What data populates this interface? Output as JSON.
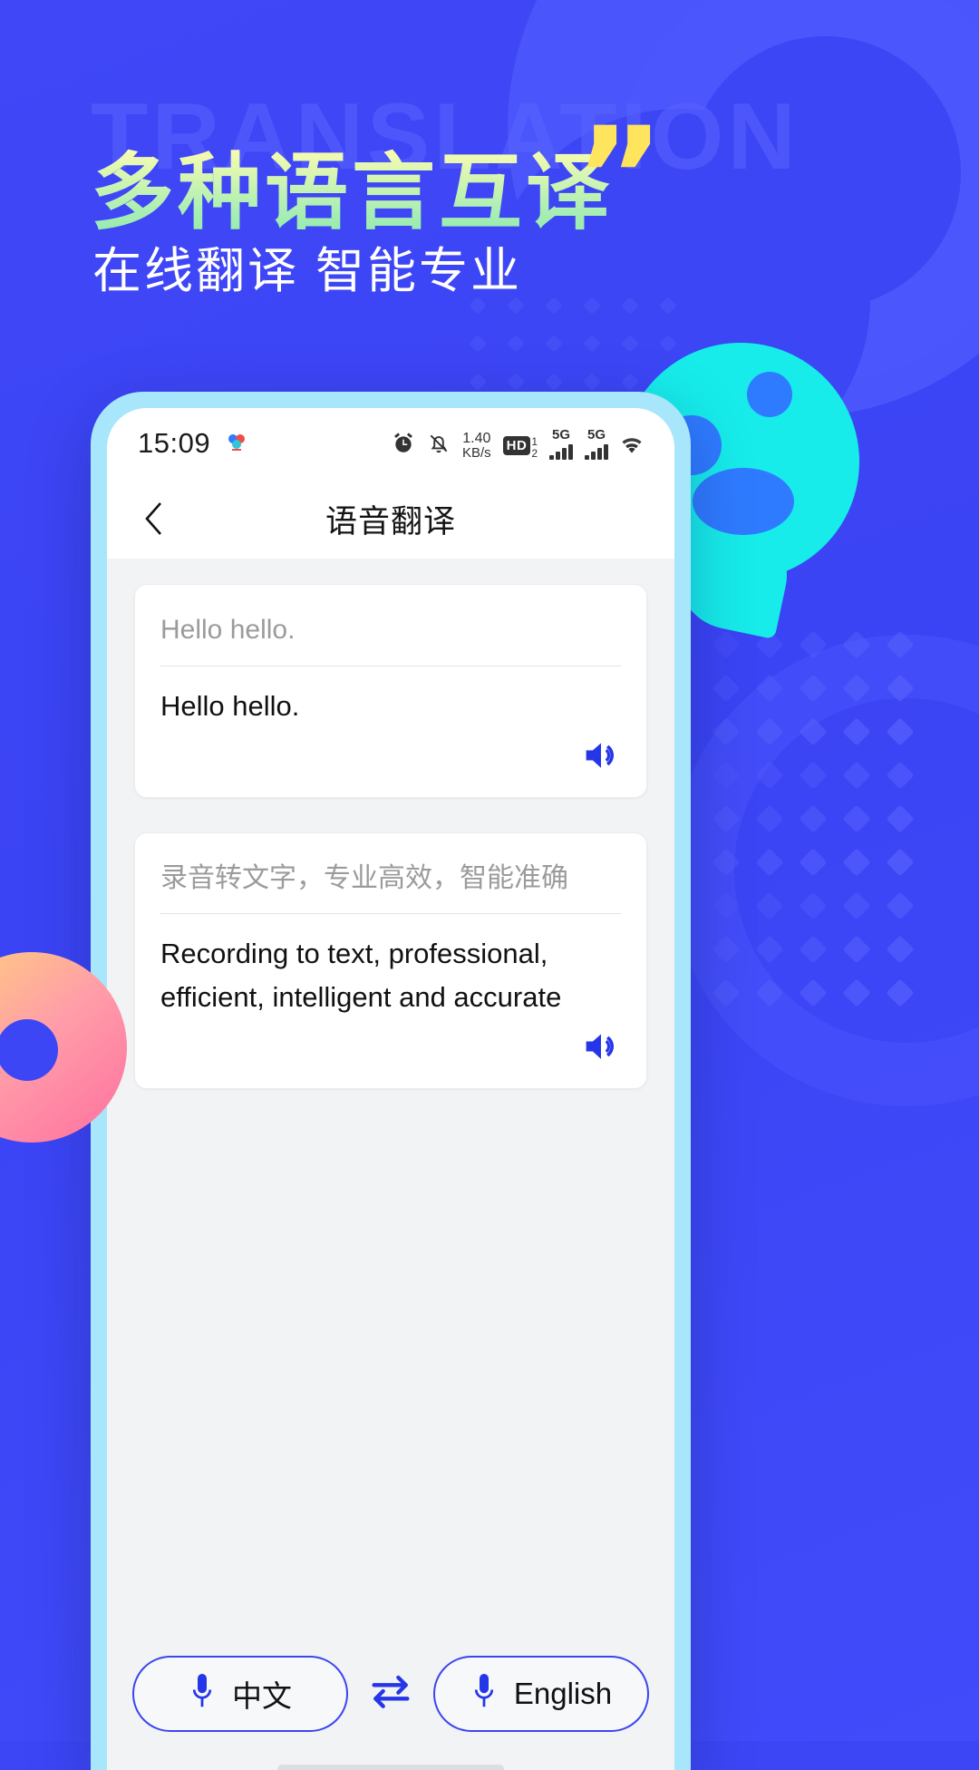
{
  "promo": {
    "ghost_word": "TRANSLATION",
    "headline": "多种语言互译",
    "quote_mark": "”",
    "subhead": "在线翻译 智能专业",
    "colors": {
      "background": "#3c46f5",
      "headline_gradient_start": "#fdfca8",
      "headline_gradient_end": "#8ae9ab",
      "quote": "#ffe45e",
      "bubble": "#17ecea",
      "phone_frame": "#a8e6fb"
    }
  },
  "phone": {
    "statusbar": {
      "time": "15:09",
      "app_icon": "app-badge-icon",
      "alarm_icon": "alarm-icon",
      "mute_icon": "bell-muted-icon",
      "net_speed_value": "1.40",
      "net_speed_unit": "KB/s",
      "hd_label": "HD",
      "hd_sim_top": "1",
      "hd_sim_bottom": "2",
      "sim1_label": "5G",
      "sim2_label": "5G",
      "wifi_icon": "wifi-icon"
    },
    "titlebar": {
      "back_icon": "back-chevron-icon",
      "title": "语音翻译"
    },
    "cards": [
      {
        "source": "Hello hello.",
        "translation": "Hello hello.",
        "speaker_icon": "speaker-icon"
      },
      {
        "source": "录音转文字，专业高效，智能准确",
        "translation": "Recording to text, professional, efficient, intelligent and accurate",
        "speaker_icon": "speaker-icon"
      }
    ],
    "collapse": {
      "icon": "chevron-double-up-icon"
    },
    "bottombar": {
      "left_lang": {
        "label": "中文",
        "mic_icon": "microphone-icon"
      },
      "swap_icon": "swap-arrows-icon",
      "right_lang": {
        "label": "English",
        "mic_icon": "microphone-icon"
      }
    }
  }
}
